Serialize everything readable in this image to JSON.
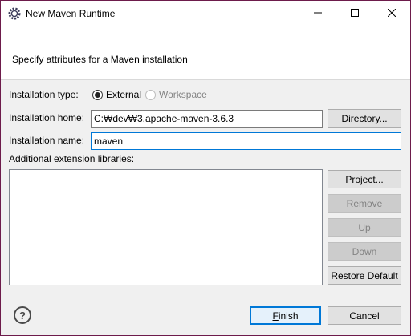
{
  "window": {
    "title": "New Maven Runtime",
    "icons": {
      "app": "gear-icon",
      "minimize": "minimize-icon",
      "maximize": "maximize-icon",
      "close": "close-icon"
    }
  },
  "banner": {
    "description": "Specify attributes for a Maven installation"
  },
  "installation_type": {
    "label": "Installation type:",
    "options": [
      {
        "label": "External",
        "selected": true,
        "enabled": true
      },
      {
        "label": "Workspace",
        "selected": false,
        "enabled": false
      }
    ]
  },
  "installation_home": {
    "label": "Installation home:",
    "value": "C:₩dev₩3.apache-maven-3.6.3",
    "button": "Directory..."
  },
  "installation_name": {
    "label": "Installation name:",
    "value": "maven"
  },
  "extensions": {
    "label": "Additional extension libraries:",
    "items": [],
    "buttons": {
      "project": "Project...",
      "remove": "Remove",
      "up": "Up",
      "down": "Down",
      "restore": "Restore Default"
    }
  },
  "footer": {
    "finish_prefix": "",
    "finish_mnemonic": "F",
    "finish_rest": "inish",
    "cancel": "Cancel",
    "help_icon": "help-icon"
  },
  "colors": {
    "window_border": "#6d1b4b",
    "focus": "#0078d7",
    "disabled_text": "#838383"
  }
}
